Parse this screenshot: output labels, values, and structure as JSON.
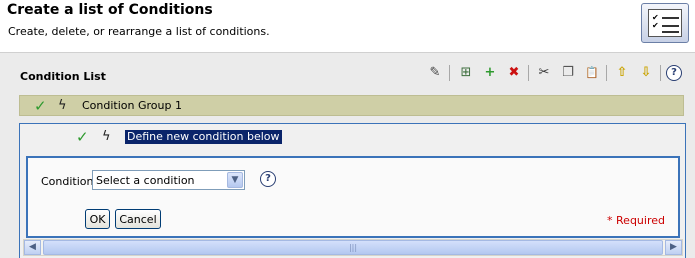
{
  "header": {
    "title": "Create a list of Conditions",
    "subtitle": "Create, delete, or rearrange a list of conditions.",
    "icon": "checklist-icon"
  },
  "list": {
    "title": "Condition List",
    "toolbar": [
      {
        "name": "edit-icon",
        "glyph": "✎"
      },
      {
        "name": "add-group-icon",
        "glyph": "⊞"
      },
      {
        "name": "add-icon",
        "glyph": "+"
      },
      {
        "name": "delete-icon",
        "glyph": "✖"
      },
      {
        "name": "cut-icon",
        "glyph": "✂"
      },
      {
        "name": "copy-icon",
        "glyph": "❐"
      },
      {
        "name": "paste-icon",
        "glyph": "📋"
      },
      {
        "name": "move-up-icon",
        "glyph": "⇧"
      },
      {
        "name": "move-down-icon",
        "glyph": "⇩"
      },
      {
        "name": "help-icon",
        "glyph": "?"
      }
    ],
    "group": {
      "label": "Condition Group 1"
    },
    "condition": {
      "label": "Define new condition below"
    }
  },
  "editor": {
    "condition_label": "Condition",
    "select_value": "Select a condition",
    "ok_label": "OK",
    "cancel_label": "Cancel",
    "required_label": "* Required"
  },
  "scrollbar": {
    "grip": "|||"
  },
  "colors": {
    "accent": "#3b73b9",
    "check": "#2e9a2e",
    "group_bg": "#cfcfa6",
    "selection": "#0a246a",
    "required": "#cc0000"
  }
}
